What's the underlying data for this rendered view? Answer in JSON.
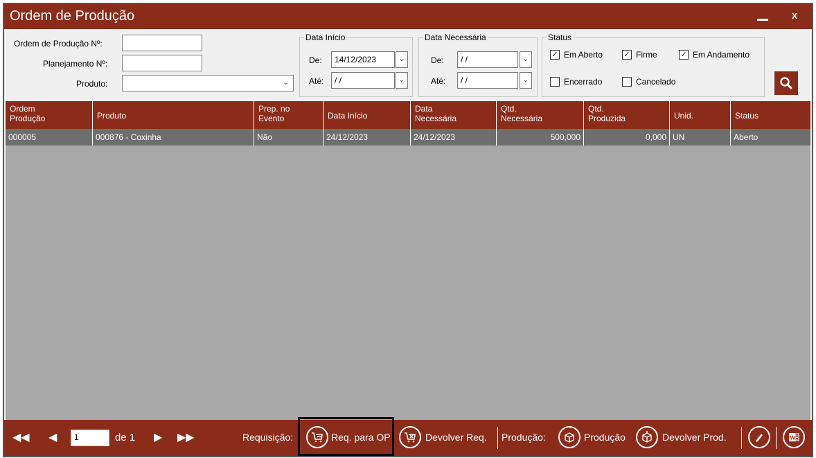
{
  "window": {
    "title": "Ordem de Produção",
    "minimize": "_",
    "close": "x"
  },
  "filters": {
    "ordem_label": "Ordem de Produção Nº:",
    "ordem_value": "",
    "planejamento_label": "Planejamento Nº:",
    "planejamento_value": "",
    "produto_label": "Produto:",
    "produto_value": "",
    "data_inicio": {
      "title": "Data Início",
      "de_label": "De:",
      "de_value": "14/12/2023",
      "ate_label": "Até:",
      "ate_value": "/ /"
    },
    "data_necessaria": {
      "title": "Data Necessária",
      "de_label": "De:",
      "de_value": "/ /",
      "ate_label": "Até:",
      "ate_value": "/ /"
    },
    "status": {
      "title": "Status",
      "em_aberto": {
        "label": "Em Aberto",
        "checked": true
      },
      "firme": {
        "label": "Firme",
        "checked": true
      },
      "em_andamento": {
        "label": "Em Andamento",
        "checked": true
      },
      "encerrado": {
        "label": "Encerrado",
        "checked": false
      },
      "cancelado": {
        "label": "Cancelado",
        "checked": false
      }
    },
    "search_icon": "search-icon"
  },
  "grid": {
    "columns": [
      {
        "l1": "Ordem",
        "l2": "Produção"
      },
      {
        "l1": "Produto",
        "l2": ""
      },
      {
        "l1": "Prep. no",
        "l2": "Evento"
      },
      {
        "l1": "Data Início",
        "l2": ""
      },
      {
        "l1": "Data",
        "l2": "Necessária"
      },
      {
        "l1": "Qtd.",
        "l2": "Necessária"
      },
      {
        "l1": "Qtd.",
        "l2": "Produzida"
      },
      {
        "l1": "Unid.",
        "l2": ""
      },
      {
        "l1": "Status",
        "l2": ""
      }
    ],
    "rows": [
      [
        "000005",
        "000876 - Coxinha",
        "Não",
        "24/12/2023",
        "24/12/2023",
        "500,000",
        "0,000",
        "UN",
        "Aberto"
      ]
    ]
  },
  "footer": {
    "page_value": "1",
    "page_of": "de 1",
    "requisicao_label": "Requisição:",
    "req_para_op": "Req. para OP",
    "devolver_req": "Devolver Req.",
    "producao_label": "Produção:",
    "producao": "Produção",
    "devolver_prod": "Devolver Prod."
  },
  "colors": {
    "accent": "#8b2b1a",
    "grid_bg": "#a8a8a8",
    "row_selected": "#6e6e6e"
  }
}
